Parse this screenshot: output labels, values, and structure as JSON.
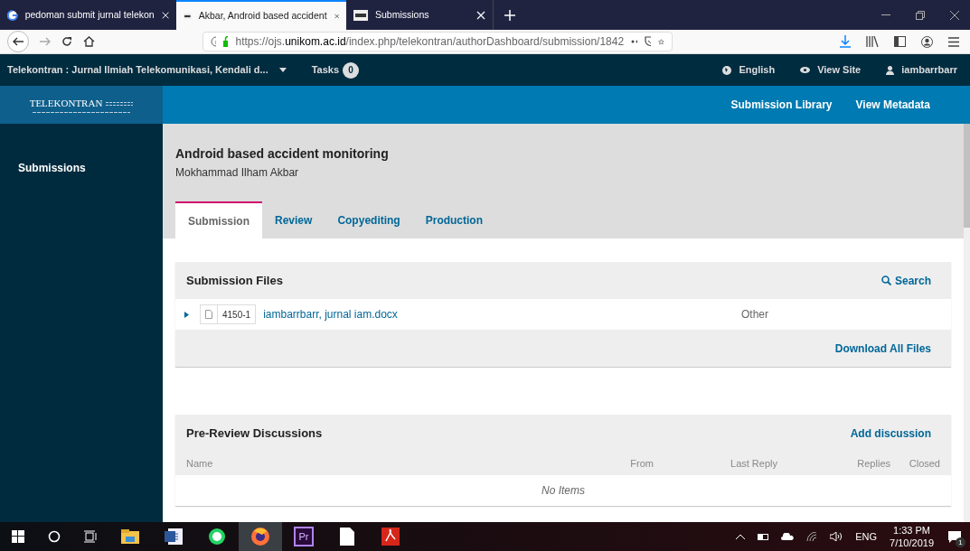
{
  "browser": {
    "tabs": [
      {
        "title": "pedoman submit jurnal telekon",
        "kind": "search",
        "selected": false
      },
      {
        "title": "Akbar, Android based accident",
        "kind": "journal",
        "selected": true
      },
      {
        "title": "Submissions",
        "kind": "journal",
        "selected": false
      }
    ],
    "url": "https://ojs.**unikom.ac.id**/index.php/telekontran/authorDashboard/submission/1842"
  },
  "topbar": {
    "context": "Telekontran : Jurnal Ilmiah Telekomunikasi, Kendali d...",
    "tasks_label": "Tasks",
    "tasks_count": "0",
    "language": "English",
    "view_site": "View Site",
    "user": "iambarrbarr"
  },
  "logo": {
    "title": "TELEKONTRAN"
  },
  "header_links": [
    "Submission Library",
    "View Metadata"
  ],
  "sidebar": {
    "items": [
      {
        "label": "Submissions",
        "selected": true
      }
    ]
  },
  "submission": {
    "title": "Android based accident monitoring",
    "author": "Mokhammad Ilham Akbar"
  },
  "tabs": [
    {
      "label": "Submission",
      "selected": true
    },
    {
      "label": "Review",
      "selected": false
    },
    {
      "label": "Copyediting",
      "selected": false
    },
    {
      "label": "Production",
      "selected": false
    }
  ],
  "files_panel": {
    "title": "Submission Files",
    "action": "Search",
    "files": [
      {
        "id": "4150-1",
        "name": "iambarrbarr, jurnal iam.docx",
        "genre": "Other"
      }
    ],
    "footer_action": "Download All Files"
  },
  "discussions_panel": {
    "title": "Pre-Review Discussions",
    "action": "Add discussion",
    "columns": [
      "Name",
      "From",
      "Last Reply",
      "Replies",
      "Closed"
    ],
    "empty": "No Items"
  },
  "taskbar": {
    "apps": [
      {
        "kind": "files",
        "active": false
      },
      {
        "kind": "word",
        "active": false
      },
      {
        "kind": "chat",
        "active": false
      },
      {
        "kind": "browser",
        "active": true
      },
      {
        "kind": "premiere",
        "label": "Pr",
        "active": false
      },
      {
        "kind": "doc",
        "active": false
      },
      {
        "kind": "pdf",
        "active": false
      }
    ],
    "language": "ENG",
    "time": "1:33 PM",
    "date": "7/10/2019",
    "notifications": "1"
  }
}
